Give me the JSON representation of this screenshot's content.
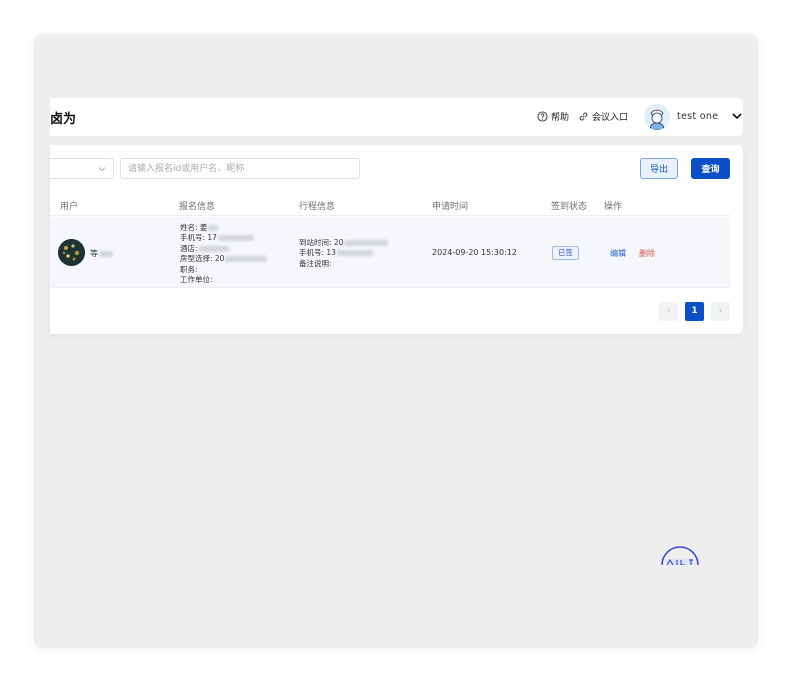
{
  "header": {
    "logo_text": "卤为",
    "help_label": "帮助",
    "meeting_label": "会议入口",
    "user_name": "test  one"
  },
  "toolbar": {
    "search_placeholder": "请输入报名id或用户名、昵称",
    "export_label": "导出",
    "query_label": "查询"
  },
  "table": {
    "columns": [
      "用户",
      "报名信息",
      "行程信息",
      "申请时间",
      "签到状态",
      "操作"
    ],
    "rows": [
      {
        "user_name": "等",
        "reg_name": "姓名: 姜",
        "reg_phone": "手机号: 17",
        "reg_hotel": "酒店:",
        "reg_room": "房型选择: 20",
        "reg_position": "职务:",
        "reg_company": "工作单位:",
        "trip_arrival": "到站时间: 20",
        "trip_phone": "手机号: 13",
        "trip_note": "备注说明:",
        "apply_time": "2024-09-20 15:30:12",
        "status": "已签",
        "edit_label": "编辑",
        "delete_label": "删除"
      }
    ]
  },
  "pagination": {
    "prev": "‹",
    "current": "1",
    "next": "›"
  },
  "colors": {
    "primary": "#0b4fc6",
    "danger": "#d9534f",
    "background": "#eeeeee"
  }
}
